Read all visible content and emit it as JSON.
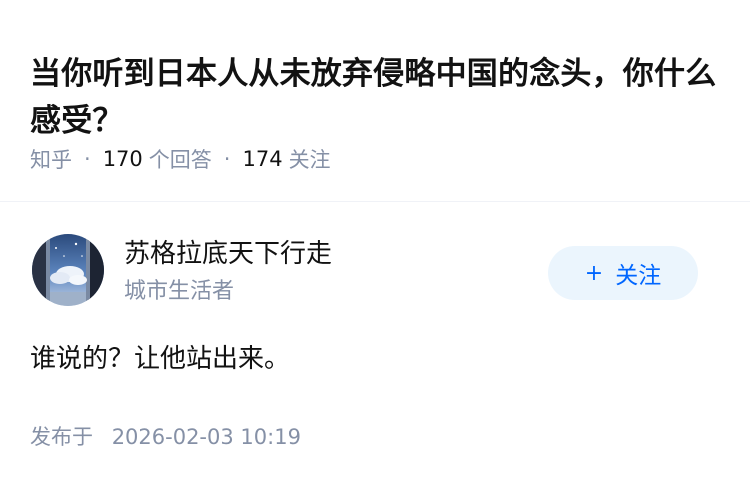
{
  "question": {
    "title": "当你听到日本人从未放弃侵略中国的念头，你什么感受？"
  },
  "meta": {
    "site": "知乎",
    "answers_count": "170",
    "answers_label": "个回答",
    "follows_count": "174",
    "follows_label": "关注"
  },
  "author": {
    "name": "苏格拉底天下行走",
    "bio": "城市生活者",
    "avatar_icon": "avatar-sky-window"
  },
  "follow_button": {
    "icon": "plus-icon",
    "plus": "+",
    "label": "关注"
  },
  "answer": {
    "content": "谁说的？让他站出来。"
  },
  "published": {
    "label": "发布于",
    "datetime": "2026-02-03 10:19"
  },
  "colors": {
    "text_primary": "#121212",
    "text_secondary": "#8590a6",
    "accent": "#0066ff",
    "button_bg": "#ebf5fd"
  }
}
